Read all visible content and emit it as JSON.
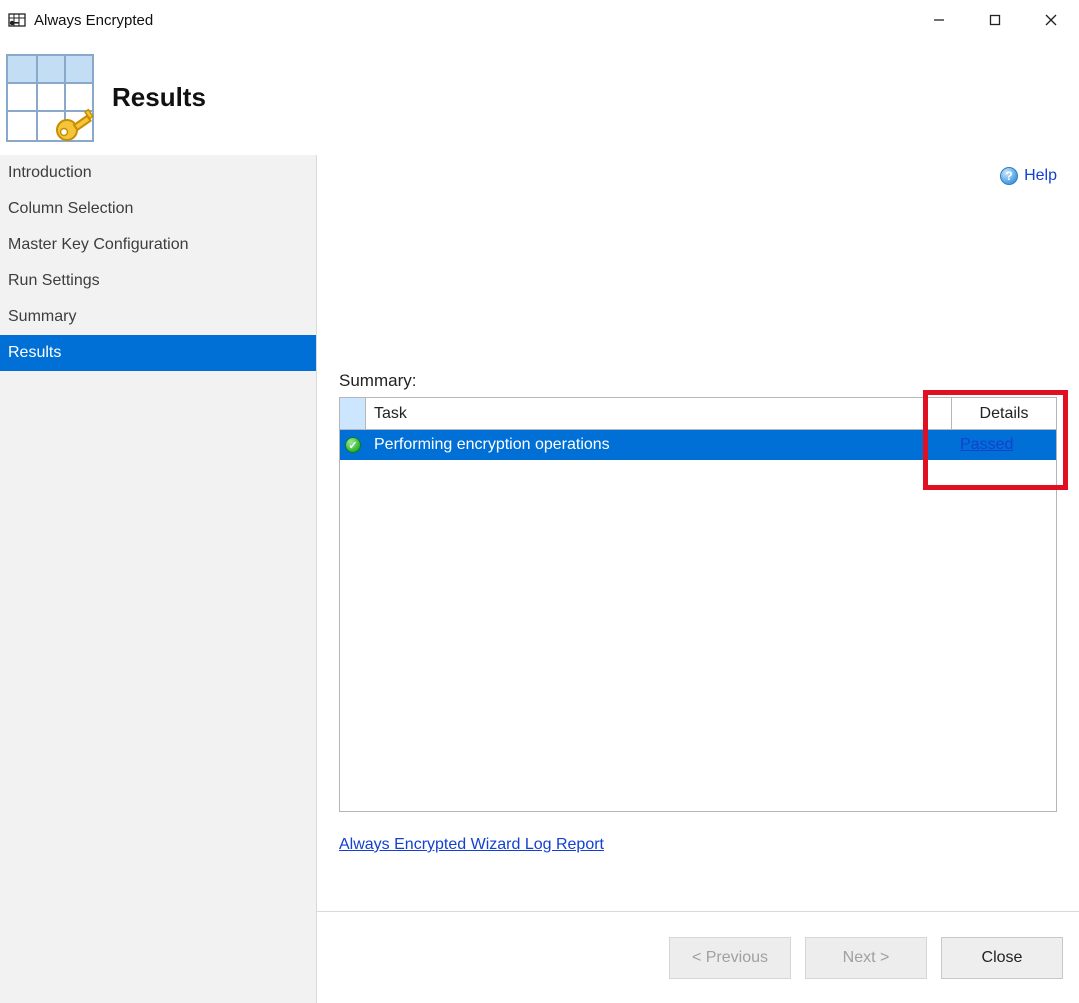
{
  "titlebar": {
    "title": "Always Encrypted"
  },
  "header": {
    "title": "Results"
  },
  "sidebar": {
    "items": [
      {
        "label": "Introduction"
      },
      {
        "label": "Column Selection"
      },
      {
        "label": "Master Key Configuration"
      },
      {
        "label": "Run Settings"
      },
      {
        "label": "Summary"
      },
      {
        "label": "Results"
      }
    ]
  },
  "main": {
    "help_label": "Help",
    "summary_label": "Summary:",
    "columns": {
      "task": "Task",
      "details": "Details"
    },
    "rows": [
      {
        "task": "Performing encryption operations",
        "details": "Passed",
        "status": "passed"
      }
    ],
    "log_report_link": "Always Encrypted Wizard Log Report"
  },
  "footer": {
    "previous_label": "< Previous",
    "next_label": "Next >",
    "close_label": "Close"
  }
}
